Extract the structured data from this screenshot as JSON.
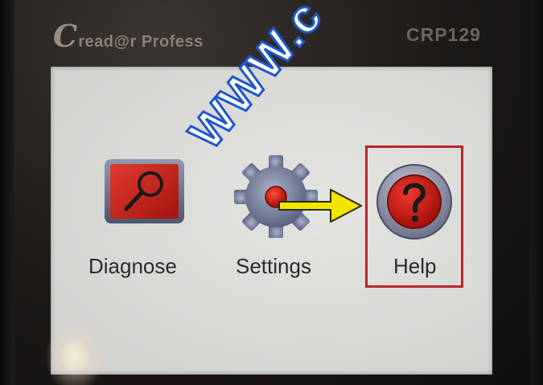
{
  "device": {
    "brand_initial": "C",
    "brand_name": "read@r Profess",
    "model": "CRP129"
  },
  "watermark": {
    "text": "WWW.c"
  },
  "menu": {
    "items": [
      {
        "label": "Diagnose",
        "icon": "magnifier-icon",
        "selected": false
      },
      {
        "label": "Settings",
        "icon": "gear-icon",
        "selected": false
      },
      {
        "label": "Help",
        "icon": "question-icon",
        "selected": true
      }
    ]
  },
  "colors": {
    "selection_frame": "#b8262a",
    "icon_red": "#c0211f",
    "arrow_yellow": "#f2e600",
    "screen_bg": "#dcdcd9",
    "watermark_stroke": "#1e57c9"
  }
}
